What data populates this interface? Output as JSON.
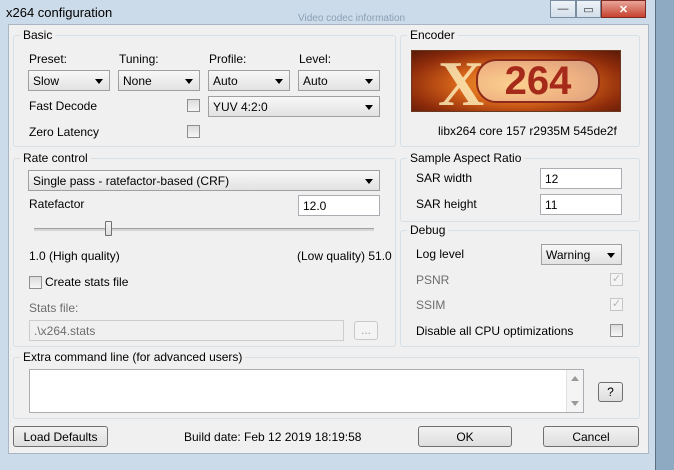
{
  "window": {
    "title": "x264 configuration",
    "ghost_text": "Video codec information",
    "controls": {
      "minimize": "—",
      "maximize": "▭",
      "close": "✕"
    }
  },
  "basic": {
    "title": "Basic",
    "preset_label": "Preset:",
    "preset_value": "Slow",
    "tuning_label": "Tuning:",
    "tuning_value": "None",
    "profile_label": "Profile:",
    "profile_value": "Auto",
    "level_label": "Level:",
    "level_value": "Auto",
    "fast_decode_label": "Fast Decode",
    "fast_decode_checked": false,
    "zero_latency_label": "Zero Latency",
    "zero_latency_checked": false,
    "colorspace_value": "YUV 4:2:0"
  },
  "encoder": {
    "title": "Encoder",
    "logo_x": "X",
    "logo_num": "264",
    "version": "libx264 core 157 r2935M 545de2f"
  },
  "rate_control": {
    "title": "Rate control",
    "mode_value": "Single pass - ratefactor-based (CRF)",
    "ratefactor_label": "Ratefactor",
    "ratefactor_value": "12.0",
    "slider_value": 12.0,
    "slider_min": 1.0,
    "slider_max": 51.0,
    "min_label": "1.0 (High quality)",
    "max_label": "(Low quality) 51.0",
    "create_stats_label": "Create stats file",
    "create_stats_checked": false,
    "stats_file_label": "Stats file:",
    "stats_file_value": ".\\x264.stats",
    "browse_label": "..."
  },
  "sar": {
    "title": "Sample Aspect Ratio",
    "width_label": "SAR width",
    "width_value": "12",
    "height_label": "SAR height",
    "height_value": "11"
  },
  "debug": {
    "title": "Debug",
    "log_level_label": "Log level",
    "log_level_value": "Warning",
    "psnr_label": "PSNR",
    "psnr_checked": true,
    "ssim_label": "SSIM",
    "ssim_checked": true,
    "disable_cpu_label": "Disable all CPU optimizations",
    "disable_cpu_checked": false
  },
  "extra": {
    "title": "Extra command line (for advanced users)",
    "value": "",
    "help_label": "?"
  },
  "footer": {
    "load_defaults_label": "Load Defaults",
    "build_date": "Build date: Feb 12 2019 18:19:58",
    "ok_label": "OK",
    "cancel_label": "Cancel"
  },
  "colors": {
    "titlebar": "#ccdbe9",
    "close_button": "#c7432f",
    "dialog": "#f0f0f0"
  }
}
